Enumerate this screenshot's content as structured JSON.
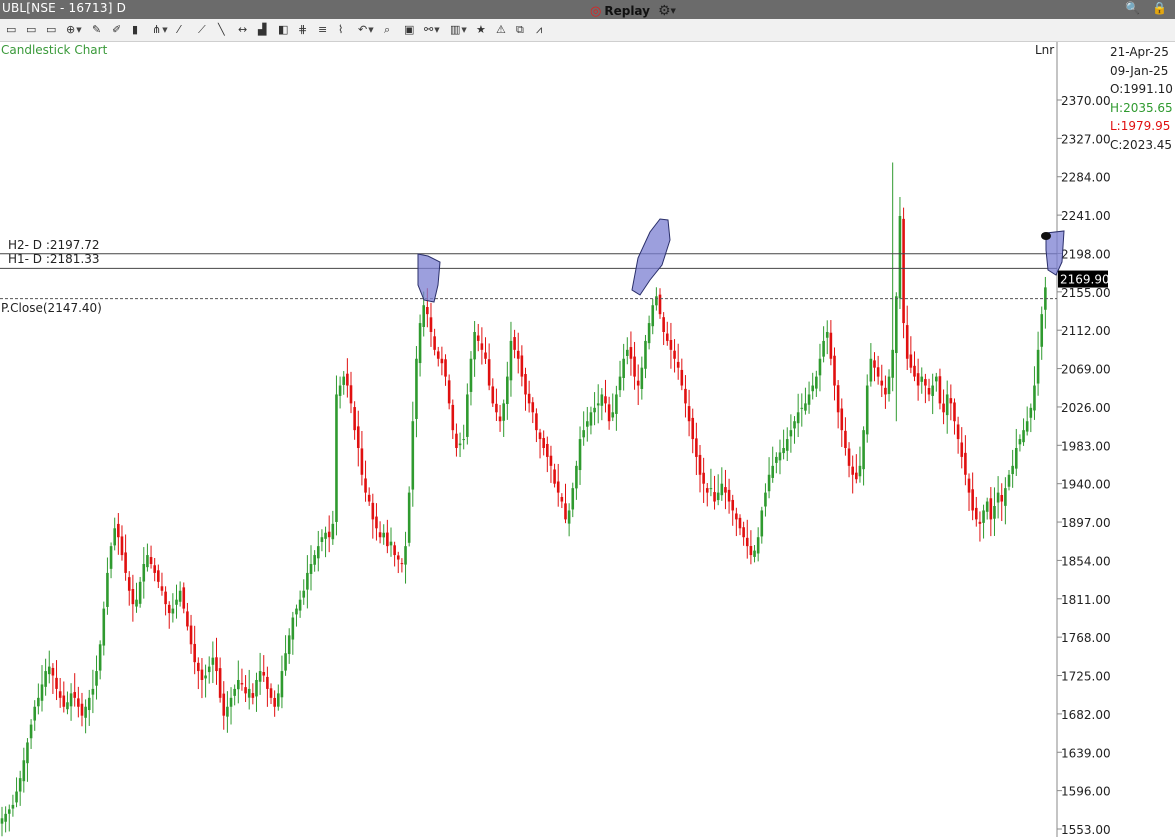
{
  "window": {
    "title": "UBL[NSE - 16713] D"
  },
  "toolbar": {
    "icons": [
      "intraday-icon",
      "daily-icon",
      "weekly-icon",
      "crosshair-icon",
      "pointer-icon",
      "pen-icon",
      "candle-type-icon",
      "indicator-icon",
      "trendline-icon",
      "ray-icon",
      "line-icon",
      "horizontal-line-icon",
      "volume-icon",
      "cube-icon",
      "fibonacci-icon",
      "parallel-lines-icon",
      "ruler-icon",
      "undo-icon",
      "zoom-icon",
      "save-icon",
      "link-icon",
      "studies-icon",
      "star-icon",
      "alert-icon",
      "template-icon",
      "compare-icon"
    ],
    "replay_label": "Replay"
  },
  "chart": {
    "label": "Candlestick Chart",
    "scale_mode": "Lnr",
    "ohlc": {
      "date1": "21-Apr-25",
      "date2": "09-Jan-25",
      "open": "O:1991.10",
      "high": "H:2035.65",
      "low": "L:1979.95",
      "close": "C:2023.45"
    },
    "levels": {
      "h2": "H2- D :2197.72",
      "h1": "H1- D :2181.33",
      "pclose": "P.Close(2147.40)"
    },
    "last_price": "2169.90",
    "colors": {
      "up": "#2f9a2f",
      "down": "#e01010",
      "highlight": "#7b7fd1"
    }
  },
  "chart_data": {
    "type": "candlestick",
    "y_ticks": [
      "2370.00",
      "2327.00",
      "2284.00",
      "2241.00",
      "2198.00",
      "2155.00",
      "2112.00",
      "2069.00",
      "2026.00",
      "1983.00",
      "1940.00",
      "1897.00",
      "1854.00",
      "1811.00",
      "1768.00",
      "1725.00",
      "1682.00",
      "1639.00",
      "1596.00",
      "1553.00"
    ],
    "ylim": [
      1553,
      2370
    ],
    "reference_lines": [
      {
        "name": "H2- D",
        "value": 2197.72,
        "style": "solid"
      },
      {
        "name": "H1- D",
        "value": 2181.33,
        "style": "solid"
      },
      {
        "name": "P.Close",
        "value": 2147.4,
        "style": "dashed"
      }
    ],
    "last_price": 2169.9,
    "closes": [
      1565,
      1570,
      1575,
      1580,
      1595,
      1610,
      1630,
      1650,
      1670,
      1690,
      1700,
      1715,
      1730,
      1735,
      1725,
      1710,
      1700,
      1690,
      1695,
      1705,
      1700,
      1690,
      1680,
      1690,
      1700,
      1710,
      1730,
      1760,
      1800,
      1840,
      1870,
      1890,
      1880,
      1860,
      1840,
      1820,
      1805,
      1810,
      1830,
      1850,
      1860,
      1850,
      1840,
      1830,
      1820,
      1805,
      1795,
      1800,
      1810,
      1820,
      1800,
      1780,
      1760,
      1740,
      1730,
      1720,
      1725,
      1735,
      1745,
      1730,
      1700,
      1680,
      1690,
      1700,
      1710,
      1720,
      1715,
      1705,
      1710,
      1700,
      1720,
      1730,
      1725,
      1710,
      1700,
      1690,
      1705,
      1730,
      1750,
      1770,
      1790,
      1800,
      1810,
      1820,
      1840,
      1850,
      1860,
      1870,
      1880,
      1885,
      1880,
      1895,
      2040,
      2050,
      2060,
      2050,
      2030,
      2000,
      1980,
      1950,
      1930,
      1920,
      1900,
      1890,
      1880,
      1885,
      1870,
      1875,
      1860,
      1855,
      1850,
      1870,
      1930,
      2010,
      2080,
      2120,
      2140,
      2130,
      2110,
      2090,
      2080,
      2075,
      2060,
      2030,
      2000,
      1980,
      1985,
      1990,
      2040,
      2080,
      2110,
      2100,
      2090,
      2080,
      2050,
      2030,
      2020,
      2010,
      2030,
      2060,
      2100,
      2090,
      2080,
      2060,
      2040,
      2030,
      2020,
      2000,
      1990,
      1980,
      1970,
      1960,
      1940,
      1930,
      1920,
      1900,
      1910,
      1935,
      1960,
      1990,
      2000,
      2010,
      2020,
      2025,
      2030,
      2040,
      2030,
      2010,
      2020,
      2040,
      2060,
      2080,
      2090,
      2080,
      2060,
      2050,
      2070,
      2100,
      2120,
      2140,
      2150,
      2130,
      2110,
      2100,
      2090,
      2080,
      2070,
      2050,
      2030,
      2010,
      1990,
      1970,
      1950,
      1940,
      1930,
      1935,
      1920,
      1930,
      1940,
      1930,
      1920,
      1910,
      1900,
      1890,
      1880,
      1870,
      1860,
      1865,
      1880,
      1910,
      1930,
      1950,
      1960,
      1970,
      1975,
      1980,
      1990,
      2000,
      2010,
      2020,
      2025,
      2030,
      2040,
      2050,
      2060,
      2080,
      2100,
      2110,
      2080,
      2050,
      2020,
      2000,
      1980,
      1960,
      1950,
      1945,
      1960,
      2000,
      2050,
      2080,
      2070,
      2060,
      2050,
      2040,
      2060,
      2090,
      2150,
      2240,
      2120,
      2080,
      2070,
      2060,
      2050,
      2060,
      2050,
      2040,
      2050,
      2060,
      2030,
      2020,
      2040,
      2030,
      2010,
      1990,
      1970,
      1950,
      1930,
      1910,
      1900,
      1895,
      1910,
      1920,
      1900,
      1915,
      1930,
      1920,
      1935,
      1950,
      1960,
      1980,
      1990,
      2000,
      2010,
      2025,
      2050,
      2090,
      2130,
      2160
    ]
  }
}
